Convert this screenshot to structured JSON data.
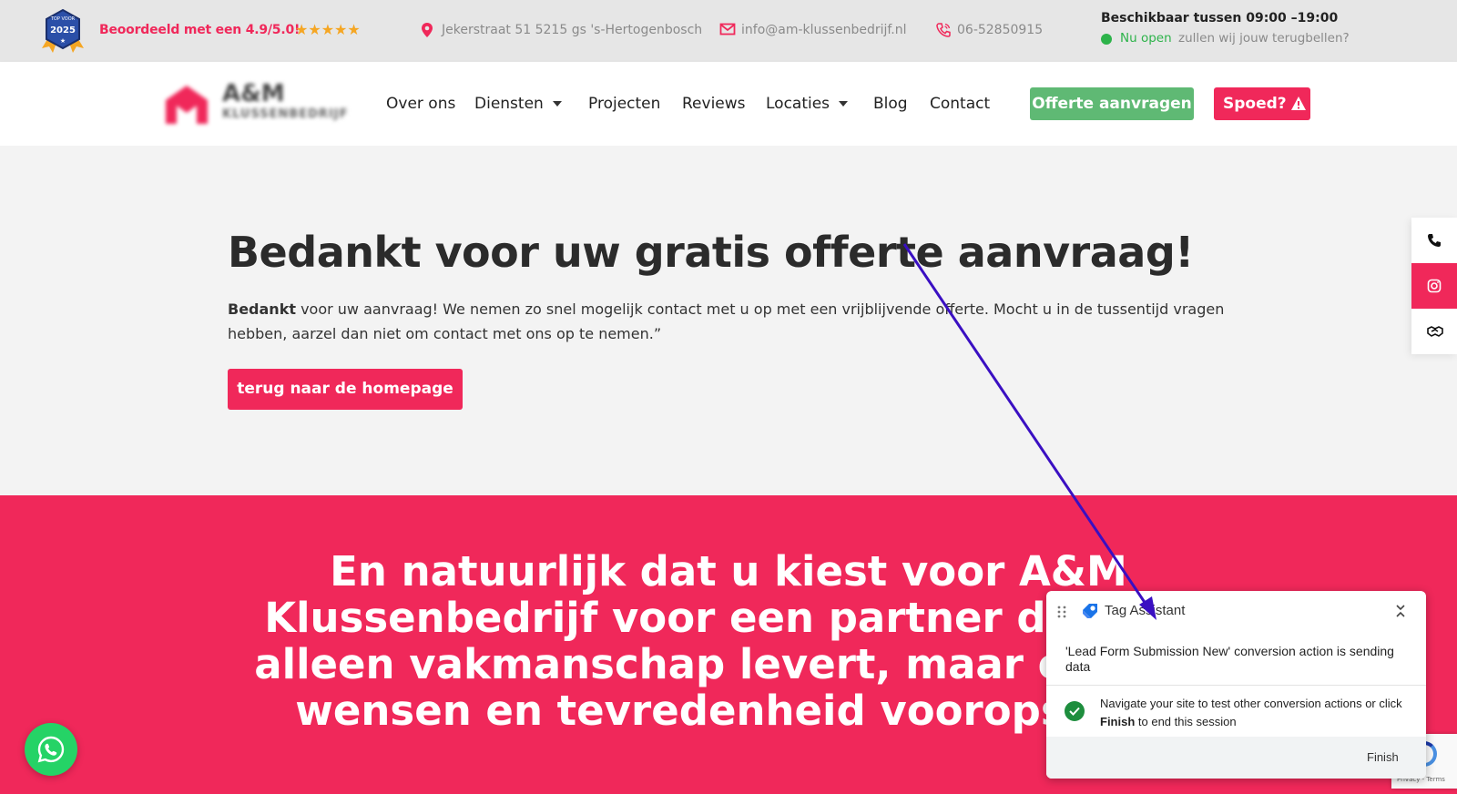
{
  "colors": {
    "brand_pink": "#f0285a",
    "green_button": "#5fb974",
    "topbar_bg": "#e6e6e6",
    "hero_bg": "#f3f3f3",
    "open_green": "#2db34a",
    "annotation_arrow": "#3a0fc2"
  },
  "topbar": {
    "badge_year": "2025",
    "rating_text": "Beoordeeld met een 4.9/5.0!",
    "stars": "★★★★★",
    "address": "Jekerstraat 51 5215 gs 's-Hertogenbosch",
    "email": "info@am-klussenbedrijf.nl",
    "phone": "06-52850915",
    "availability_title": "Beschikbaar tussen 09:00 –19:00",
    "open_label": "Nu open",
    "callback_text": "zullen wij jouw terugbellen?"
  },
  "nav": {
    "logo_title": "A&M",
    "logo_subtitle": "KLUSSENBEDRIJF",
    "items": [
      {
        "label": "Over ons"
      },
      {
        "label": "Diensten"
      },
      {
        "label": "Projecten"
      },
      {
        "label": "Reviews"
      },
      {
        "label": "Locaties"
      },
      {
        "label": "Blog"
      },
      {
        "label": "Contact"
      }
    ],
    "cta_quote": "Offerte aanvragen",
    "cta_urgent": "Spoed?"
  },
  "hero": {
    "title": "Bedankt voor uw gratis offerte aanvraag!",
    "lead_bold": "Bedankt",
    "lead_text": " voor uw aanvraag! We nemen zo snel mogelijk contact met u op met een vrijblijvende offerte. Mocht u in de tussentijd vragen hebben, aarzel dan niet om contact met ons op te nemen.”",
    "home_button": "terug naar de homepage"
  },
  "pink_section": {
    "heading": "En natuurlijk dat u kiest voor A&M Klussenbedrijf voor een partner die niet alleen vakmanschap levert, maar ook uw wensen en tevredenheid vooropstelt."
  },
  "side_icons": [
    "phone-icon",
    "instagram-icon",
    "handshake-icon"
  ],
  "recaptcha": {
    "text": "Privacy - Terms"
  },
  "tag_assistant": {
    "title": "Tag Assistant",
    "message": "'Lead Form Submission New' conversion action is sending data",
    "info_pre": "Navigate your site to test other conversion actions or click ",
    "info_bold": "Finish",
    "info_post": " to end this session",
    "finish_button": "Finish"
  }
}
